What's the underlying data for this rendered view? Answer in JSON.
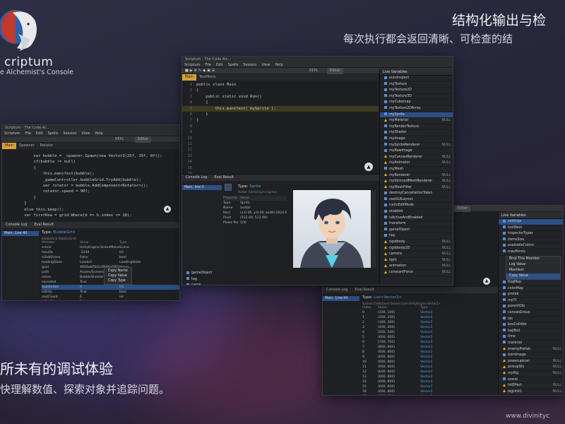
{
  "brand": {
    "name": "criptum",
    "subtitle": "e Alchemist's Console"
  },
  "tagline": {
    "title": "结构化输出与检",
    "subtitle": "每次执行都会返回清晰、可检查的结"
  },
  "promo": {
    "title": "所未有的调试体验",
    "subtitle": "快理解数值、探索对象并追踪问题。"
  },
  "website": "www.divinityc",
  "main_window": {
    "title": "Scriptum - The Code Alc...",
    "menu": [
      "Scriptum",
      "File",
      "Edit",
      "Spells",
      "Session",
      "View",
      "Help"
    ],
    "toolbar_tabs": [
      "REPL",
      "Editor"
    ],
    "file_tabs": [
      "Main",
      "TestMono"
    ],
    "code_lines": [
      {
        "n": "1",
        "text": "public class Main"
      },
      {
        "n": "2",
        "text": "{"
      },
      {
        "n": "3",
        "text": "    public static void Run()"
      },
      {
        "n": "4",
        "text": "    {"
      },
      {
        "n": "5",
        "text": "        this.manifest( mySprite );"
      },
      {
        "n": "6",
        "text": "    }"
      },
      {
        "n": "7",
        "text": "}"
      },
      {
        "n": "8",
        "text": ""
      },
      {
        "n": "9",
        "text": ""
      },
      {
        "n": "10",
        "text": ""
      },
      {
        "n": "11",
        "text": ""
      },
      {
        "n": "12",
        "text": ""
      },
      {
        "n": "13",
        "text": ""
      },
      {
        "n": "14",
        "text": ""
      },
      {
        "n": "15",
        "text": ""
      },
      {
        "n": "16",
        "text": ""
      },
      {
        "n": "17",
        "text": ""
      },
      {
        "n": "18",
        "text": ""
      },
      {
        "n": "19",
        "text": ""
      }
    ],
    "live_vars_title": "Live Variables",
    "live_vars": [
      {
        "name": "autoInspect",
        "null": ""
      },
      {
        "name": "myTexture",
        "null": ""
      },
      {
        "name": "myTexture2D",
        "null": ""
      },
      {
        "name": "myTexture3D",
        "null": ""
      },
      {
        "name": "myCubemap",
        "null": ""
      },
      {
        "name": "myTexture2DArray",
        "null": ""
      },
      {
        "name": "mySprite",
        "null": "",
        "sel": true
      },
      {
        "name": "myMaterial",
        "null": "NULL",
        "warn": true
      },
      {
        "name": "myRenderTexture",
        "null": ""
      },
      {
        "name": "myShader",
        "null": ""
      },
      {
        "name": "myImage",
        "null": ""
      },
      {
        "name": "mySpriteRenderer",
        "null": "NULL"
      },
      {
        "name": "myRawImage",
        "null": ""
      },
      {
        "name": "myCanvasRenderer",
        "null": "NULL",
        "warn": true
      },
      {
        "name": "myAnimator",
        "null": "NULL",
        "warn": true
      },
      {
        "name": "myMesh",
        "null": ""
      },
      {
        "name": "myRenderer",
        "null": "NULL",
        "warn": true
      },
      {
        "name": "mySkinnedMeshRenderer",
        "null": "NULL",
        "warn": true
      },
      {
        "name": "myMeshFilter",
        "null": "NULL",
        "warn": true
      },
      {
        "name": "destroyCancellationToken",
        "null": ""
      },
      {
        "name": "useGUILayout",
        "null": ""
      },
      {
        "name": "runInEditMode",
        "null": ""
      },
      {
        "name": "enabled",
        "null": ""
      },
      {
        "name": "isActiveAndEnabled",
        "null": ""
      },
      {
        "name": "transform",
        "null": ""
      },
      {
        "name": "gameObject",
        "null": ""
      },
      {
        "name": "tag",
        "null": ""
      },
      {
        "name": "rigidbody",
        "null": "NULL",
        "warn": true
      },
      {
        "name": "rigidbody2D",
        "null": "NULL",
        "warn": true
      },
      {
        "name": "camera",
        "null": "NULL",
        "warn": true
      },
      {
        "name": "light",
        "null": "NULL",
        "warn": true
      },
      {
        "name": "animation",
        "null": "NULL",
        "warn": true
      },
      {
        "name": "constantForce",
        "null": "NULL",
        "warn": true
      }
    ],
    "bottom_tabs": [
      "Console Log",
      "Eval Result"
    ],
    "result_entry": "Main: line:5",
    "result_type_label": "Type:",
    "result_type": "Sprite",
    "result_path": "Avatar (UnityEngine.Sprite)",
    "result_headers": [
      "Property",
      "Value"
    ],
    "result_rows": [
      {
        "k": "Type",
        "v": "Sprite"
      },
      {
        "k": "Name",
        "v": "avatar"
      },
      {
        "k": "Rect",
        "v": "(x:0.00, y:0.00, width:1024.00, he"
      },
      {
        "k": "Pivot",
        "v": "(512.00, 512.00)"
      },
      {
        "k": "Pixels Per",
        "v": "100"
      }
    ],
    "scroll_items": [
      "gameObject",
      "tag",
      "name",
      "hideFlags"
    ]
  },
  "left_window": {
    "title": "Scriptum - The Code Al...",
    "menu": [
      "Scriptum",
      "File",
      "Edit",
      "Spells",
      "Session",
      "View",
      "Help"
    ],
    "toolbar_tabs": [
      "REPL",
      "Editor"
    ],
    "file_tabs": [
      "Main",
      "Spawner",
      "Rotator"
    ],
    "code_lines": [
      "        var bubble = _spawner.Spawn(new Vector3(25f, 15f, 0f));",
      "        if(bubble != null)",
      "        {",
      "            this.manifest(bubble);",
      "            _gameController.bubbleGrid.TryAdd(bubble);",
      "",
      "            var rotator = bubble.AddComponent<Rotator>();",
      "            rotator.speed = 90f;",
      "        }",
      "    }",
      "    else this.beep();",
      "",
      "    var firstRow = grid.Where(b => b.index <= 10);"
    ],
    "bottom_tabs": [
      "Console Log",
      "Eval Result"
    ],
    "result_entry": "Main: Line:40",
    "result_type_label": "Type:",
    "result_type": "BubbleGrid",
    "result_path": "BubbleGrid (BubbleGrid)",
    "table_headers": [
      "Member",
      "Value",
      "Type"
    ],
    "table_rows": [
      {
        "m": "scene",
        "v": "UnityEngine.SceneManagement",
        "t": "Scene"
      },
      {
        "m": "handle",
        "v": "-1244",
        "t": "int"
      },
      {
        "m": "isSubScene",
        "v": "False",
        "t": "bool"
      },
      {
        "m": "loadingState",
        "v": "Loaded",
        "t": "LoadingState"
      },
      {
        "m": "guid",
        "v": "4950ebf5b5cf4bf4a5f87e52bff1d80e",
        "t": "string"
      },
      {
        "m": "path",
        "v": "Assets/Scenes/BubbleShooter.unity",
        "t": "string"
      },
      {
        "m": "name",
        "v": "BubbleShooter",
        "t": "string"
      },
      {
        "m": "isLoaded",
        "v": "True",
        "t": "bool"
      },
      {
        "m": "buildIndex",
        "v": "0",
        "t": "int"
      },
      {
        "m": "isDirty",
        "v": "True",
        "t": "bool"
      },
      {
        "m": "rootCount",
        "v": "6",
        "t": "int"
      },
      {
        "m": "isSubScene",
        "v": "False",
        "t": "bool"
      },
      {
        "m": "sceneCullingMask",
        "v": "9314069017440647994",
        "t": "ulong"
      },
      {
        "m": "gameObject",
        "v": "BubbleGrid",
        "t": "GameObject"
      },
      {
        "m": "name",
        "v": "BubbleGrid",
        "t": "string"
      },
      {
        "m": "hideFlags",
        "v": "None",
        "t": "HideFlags"
      },
      {
        "m": "tag",
        "v": "Untagged",
        "t": "string"
      },
      {
        "m": "name",
        "v": "BubbleGrid",
        "t": "string"
      }
    ],
    "context_menu": [
      "Copy Name",
      "Copy Value",
      "Copy Type"
    ]
  },
  "right_window": {
    "toolbar_tabs": [
      "Editor"
    ],
    "live_vars_title": "Live Variables",
    "live_vars": [
      {
        "name": "settings",
        "null": "",
        "sel": true
      },
      {
        "name": "lootNext",
        "null": ""
      },
      {
        "name": "inspectorTypes",
        "null": ""
      },
      {
        "name": "itemsSize",
        "null": ""
      },
      {
        "name": "availableColors",
        "null": ""
      },
      {
        "name": "maxPoints",
        "null": ""
      }
    ],
    "context_menu": [
      "Bind This Member",
      "Log Value",
      "Manifest",
      "Copy Value"
    ],
    "live_vars_more": [
      {
        "name": "flagMap",
        "null": ""
      },
      {
        "name": "colorMap",
        "null": ""
      },
      {
        "name": "prefab",
        "null": ""
      },
      {
        "name": "myTf",
        "null": ""
      },
      {
        "name": "parentObj",
        "null": ""
      },
      {
        "name": "canvasGroup",
        "null": ""
      },
      {
        "name": "ids",
        "null": ""
      },
      {
        "name": "boxCollider",
        "null": ""
      },
      {
        "name": "tagText",
        "null": ""
      },
      {
        "name": "time",
        "null": ""
      },
      {
        "name": "material",
        "null": ""
      },
      {
        "name": "enemyPrefab",
        "null": "NULL",
        "warn": true
      },
      {
        "name": "itemImage",
        "null": ""
      },
      {
        "name": "powerupIcon",
        "null": "NULL",
        "warn": true
      },
      {
        "name": "pickupSfx",
        "null": "NULL",
        "warn": true
      },
      {
        "name": "myRig",
        "null": "NULL",
        "warn": true
      },
      {
        "name": "scene",
        "null": ""
      },
      {
        "name": "hitEffect",
        "null": "NULL",
        "warn": true
      },
      {
        "name": "bigUnit1",
        "null": "NULL",
        "warn": true
      },
      {
        "name": "bigUnit2",
        "null": "NULL",
        "warn": true
      },
      {
        "name": "bigUnit3",
        "null": "NULL",
        "warn": true
      },
      {
        "name": "bossA",
        "null": "NULL",
        "warn": true
      }
    ],
    "bottom_tabs": [
      "Console Log",
      "Eval Result"
    ],
    "result_entry": "Main: Line:44",
    "result_type_label": "Type:",
    "result_type": "List<Vector2>",
    "result_path": "System.Collections.Generic.List<UnityEngine.Vector2>",
    "table_headers": [
      "Index",
      "Value",
      "Type"
    ],
    "table_rows": [
      {
        "i": "0",
        "v": "(100, 100)",
        "t": "Vector2"
      },
      {
        "i": "1",
        "v": "(200, 100)",
        "t": "Vector2"
      },
      {
        "i": "2",
        "v": "(300, 300)",
        "t": "Vector2"
      },
      {
        "i": "3",
        "v": "(400, 400)",
        "t": "Vector2"
      },
      {
        "i": "4",
        "v": "(500, 500)",
        "t": "Vector2"
      },
      {
        "i": "5",
        "v": "(600, 600)",
        "t": "Vector2"
      },
      {
        "i": "6",
        "v": "(700, 700)",
        "t": "Vector2"
      },
      {
        "i": "7",
        "v": "(800, 800)",
        "t": "Vector2"
      },
      {
        "i": "8",
        "v": "(600, 800)",
        "t": "Vector2"
      },
      {
        "i": "9",
        "v": "(600, 800)",
        "t": "Vector2"
      },
      {
        "i": "10",
        "v": "(600, 800)",
        "t": "Vector2"
      },
      {
        "i": "11",
        "v": "(600, 800)",
        "t": "Vector2"
      },
      {
        "i": "12",
        "v": "(600, 800)",
        "t": "Vector2"
      },
      {
        "i": "13",
        "v": "(600, 800)",
        "t": "Vector2"
      },
      {
        "i": "14",
        "v": "(600, 800)",
        "t": "Vector2"
      },
      {
        "i": "15",
        "v": "(600, 800)",
        "t": "Vector2"
      },
      {
        "i": "16",
        "v": "(600, 800)",
        "t": "Vector2"
      },
      {
        "i": "17",
        "v": "(600, 800)",
        "t": "Vector2"
      },
      {
        "i": "18",
        "v": "(600, 800)",
        "t": "Vector2"
      },
      {
        "i": "19",
        "v": "(600, 800)",
        "t": "Vector2"
      }
    ]
  },
  "colors": {
    "accent": "#d8a033",
    "selection": "#2c4f86",
    "type_blue": "#4fa3e8"
  }
}
